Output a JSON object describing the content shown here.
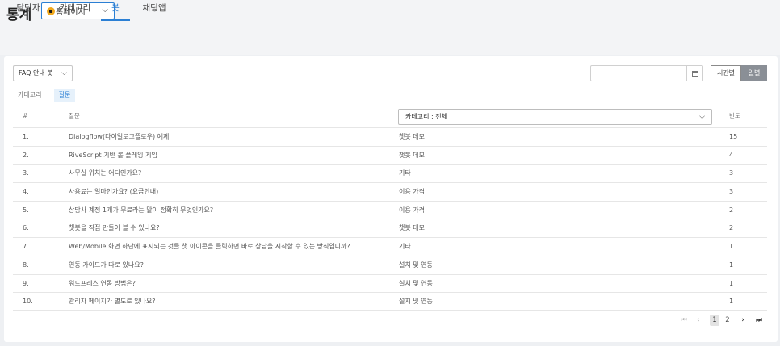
{
  "header": {
    "title": "통계",
    "site_selector": {
      "value": "홈페이지"
    }
  },
  "tabs": [
    {
      "label": "담당자"
    },
    {
      "label": "카테고리"
    },
    {
      "label": "봇",
      "active": true
    },
    {
      "label": "채팅앱"
    }
  ],
  "filters": {
    "bot_select": "FAQ 안내 봇",
    "date_value": "",
    "view_toggle": {
      "hourly": "시간별",
      "daily": "일별",
      "selected": "daily"
    }
  },
  "subtabs": [
    {
      "label": "카테고리"
    },
    {
      "label": "질문",
      "active": true
    }
  ],
  "table": {
    "columns": {
      "no": "#",
      "question": "질문",
      "count": "빈도"
    },
    "category_filter": "카테고리 : 전체",
    "rows": [
      {
        "no": "1.",
        "question": "Dialogflow(다이얼로그플로우) 예제",
        "category": "챗봇 데모",
        "count": "15"
      },
      {
        "no": "2.",
        "question": "RiveScript 기반 롤 플레잉 게임",
        "category": "챗봇 데모",
        "count": "4"
      },
      {
        "no": "3.",
        "question": "사무실 위치는 어디인가요?",
        "category": "기타",
        "count": "3"
      },
      {
        "no": "4.",
        "question": "사용료는 얼마인가요? (요금안내)",
        "category": "이용 가격",
        "count": "3"
      },
      {
        "no": "5.",
        "question": "상담사 계정 1개가 무료라는 말이 정확히 무엇인가요?",
        "category": "이용 가격",
        "count": "2"
      },
      {
        "no": "6.",
        "question": "챗봇을 직접 만들어 볼 수 있나요?",
        "category": "챗봇 데모",
        "count": "2"
      },
      {
        "no": "7.",
        "question": "Web/Mobile 화면 하단에 표시되는 것들 챗 아이콘을 클릭하면 바로 상담을 시작할 수 있는 방식입니까?",
        "category": "기타",
        "count": "1"
      },
      {
        "no": "8.",
        "question": "연동 가이드가 따로 있나요?",
        "category": "설치 및 연동",
        "count": "1"
      },
      {
        "no": "9.",
        "question": "워드프레스 연동 방법은?",
        "category": "설치 및 연동",
        "count": "1"
      },
      {
        "no": "10.",
        "question": "관리자 페이지가 별도로 있나요?",
        "category": "설치 및 연동",
        "count": "1"
      }
    ]
  },
  "pagination": {
    "first": "⏮",
    "prev": "‹",
    "pages": [
      "1",
      "2"
    ],
    "current": "1",
    "next": "›",
    "last": "⏭"
  },
  "colors": {
    "accent": "#2b7fd4",
    "toggle_active": "#8a8f96"
  }
}
